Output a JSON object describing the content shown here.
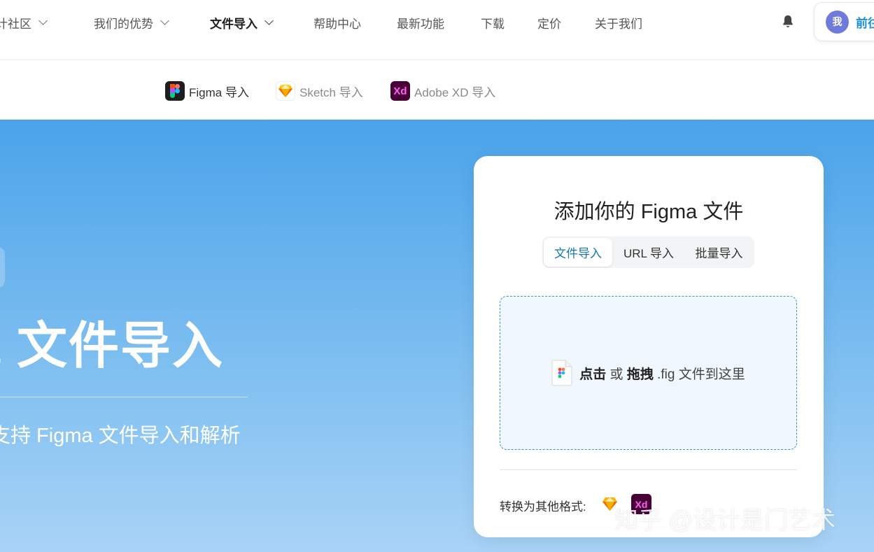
{
  "topnav": {
    "items": [
      {
        "label": "设计社区",
        "visible_label": "计社区",
        "has_dropdown": true
      },
      {
        "label": "我们的优势",
        "has_dropdown": true
      },
      {
        "label": "文件导入",
        "has_dropdown": true,
        "active": true
      },
      {
        "label": "帮助中心",
        "has_dropdown": false
      },
      {
        "label": "最新功能",
        "has_dropdown": false
      },
      {
        "label": "下载",
        "has_dropdown": false
      },
      {
        "label": "定价",
        "has_dropdown": false
      },
      {
        "label": "关于我们",
        "has_dropdown": false
      }
    ],
    "bell_icon": "bell-icon",
    "user": {
      "avatar_text": "我",
      "name": "前往"
    }
  },
  "subnav": {
    "items": [
      {
        "label": "Figma 导入",
        "icon": "figma-icon",
        "active": true
      },
      {
        "label": "Sketch 导入",
        "icon": "sketch-icon",
        "active": false
      },
      {
        "label": "Adobe XD 导入",
        "icon": "xd-icon",
        "icon_text": "Xd",
        "active": false
      }
    ]
  },
  "hero": {
    "title": "a 文件导入",
    "subtitle": "支持 Figma 文件导入和解析"
  },
  "upload_card": {
    "title": "添加你的 Figma 文件",
    "tabs": [
      {
        "label": "文件导入",
        "active": true
      },
      {
        "label": "URL 导入",
        "active": false
      },
      {
        "label": "批量导入",
        "active": false
      }
    ],
    "dropzone": {
      "click_text": "点击",
      "or_text": "或",
      "drag_text": "拖拽",
      "suffix_text": ".fig 文件到这里"
    },
    "convert_label": "转换为其他格式:",
    "convert_icons": [
      "sketch-icon",
      "xd-icon"
    ]
  },
  "watermark": "知乎 @设计是门艺术",
  "colors": {
    "accent": "#1677b3",
    "hero_top": "#4aa3ea",
    "hero_bottom": "#a9d3f6",
    "user_name": "#1b8fd6",
    "xd_bg": "#470137",
    "xd_fg": "#ff61f6"
  }
}
